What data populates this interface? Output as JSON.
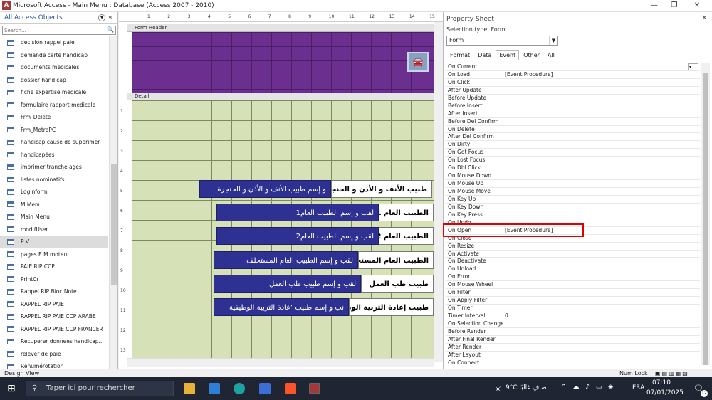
{
  "window": {
    "title": "Microsoft Access - Main Menu : Database (Access 2007 - 2010)",
    "icon": "A"
  },
  "nav": {
    "header": "All Access Objects",
    "search_placeholder": "Search...",
    "items": [
      {
        "label": "decision rappel paie"
      },
      {
        "label": "demande carte handicap"
      },
      {
        "label": "documents medicales"
      },
      {
        "label": "dossier handicap"
      },
      {
        "label": "fiche expertise medicale"
      },
      {
        "label": "formulaire rapport medicale"
      },
      {
        "label": "Frm_Delete"
      },
      {
        "label": "Frm_MetroPC"
      },
      {
        "label": "handicap cause de supprimer"
      },
      {
        "label": "handicapées"
      },
      {
        "label": "imprimer tranche ages"
      },
      {
        "label": "listes nominatifs"
      },
      {
        "label": "Loginform"
      },
      {
        "label": "M Menu"
      },
      {
        "label": "Main Menu"
      },
      {
        "label": "modifUser"
      },
      {
        "label": "P V",
        "selected": true
      },
      {
        "label": "pages E M moteur"
      },
      {
        "label": "PAIE RIP CCP"
      },
      {
        "label": "PrintCr"
      },
      {
        "label": "Rappel RIP Bloc Note"
      },
      {
        "label": "RAPPEL RIP PAIE"
      },
      {
        "label": "RAPPEL RIP PAIE CCP ARABE"
      },
      {
        "label": "RAPPEL RIP PAIE CCP FRANCER"
      },
      {
        "label": "Recuperer donnees handicap..."
      },
      {
        "label": "relever de paie"
      },
      {
        "label": "Renumérotation"
      }
    ]
  },
  "design": {
    "ruler_top": [
      "1",
      "2",
      "3",
      "4",
      "5",
      "6",
      "7",
      "8",
      "9",
      "10",
      "11",
      "12",
      "13",
      "14",
      "15"
    ],
    "ruler_left": [
      "1",
      "2",
      "3",
      "4",
      "5",
      "6",
      "7",
      "8",
      "9",
      "10",
      "11",
      "12",
      "13"
    ],
    "form_header_label": "Form Header",
    "detail_label": "Detail",
    "controls": [
      {
        "text": "و إسم طبيب الأنف و الأذن و الحنجرة",
        "style": "blue"
      },
      {
        "text": "طبيب الأنف و الأذن و الحنجرة",
        "style": "white"
      },
      {
        "text": "لقب و إسم الطبيب العام1",
        "style": "blue"
      },
      {
        "text": "الطبيب العام 1",
        "style": "white"
      },
      {
        "text": "لقب و إسم الطبيب العام2",
        "style": "blue"
      },
      {
        "text": "الطبيب العام 2",
        "style": "white"
      },
      {
        "text": "لقب و إسم الطبيب العام المستخلف",
        "style": "blue"
      },
      {
        "text": "الطبيب العام المستخلف",
        "style": "white"
      },
      {
        "text": "لقب و إسم طبيب طب العمل",
        "style": "blue"
      },
      {
        "text": "طبيب طب العمل",
        "style": "white"
      },
      {
        "text": "نب و إسم طبيب ’عادة التربية الوظيفية",
        "style": "blue"
      },
      {
        "text": "طبيب إعادة التربية الوظيفية",
        "style": "white"
      }
    ]
  },
  "property_sheet": {
    "title": "Property Sheet",
    "selection_type": "Selection type:  Form",
    "selected_object": "Form",
    "tabs": [
      "Format",
      "Data",
      "Event",
      "Other",
      "All"
    ],
    "active_tab": "Event",
    "highlighted_row": "On Open",
    "rows": [
      {
        "name": "On Current",
        "value": ""
      },
      {
        "name": "On Load",
        "value": "[Event Procedure]"
      },
      {
        "name": "On Click",
        "value": ""
      },
      {
        "name": "After Update",
        "value": ""
      },
      {
        "name": "Before Update",
        "value": ""
      },
      {
        "name": "Before Insert",
        "value": ""
      },
      {
        "name": "After Insert",
        "value": ""
      },
      {
        "name": "Before Del Confirm",
        "value": ""
      },
      {
        "name": "On Delete",
        "value": ""
      },
      {
        "name": "After Del Confirm",
        "value": ""
      },
      {
        "name": "On Dirty",
        "value": ""
      },
      {
        "name": "On Got Focus",
        "value": ""
      },
      {
        "name": "On Lost Focus",
        "value": ""
      },
      {
        "name": "On Dbl Click",
        "value": ""
      },
      {
        "name": "On Mouse Down",
        "value": ""
      },
      {
        "name": "On Mouse Up",
        "value": ""
      },
      {
        "name": "On Mouse Move",
        "value": ""
      },
      {
        "name": "On Key Up",
        "value": ""
      },
      {
        "name": "On Key Down",
        "value": ""
      },
      {
        "name": "On Key Press",
        "value": ""
      },
      {
        "name": "On Undo",
        "value": ""
      },
      {
        "name": "On Open",
        "value": "[Event Procedure]"
      },
      {
        "name": "On Close",
        "value": ""
      },
      {
        "name": "On Resize",
        "value": ""
      },
      {
        "name": "On Activate",
        "value": ""
      },
      {
        "name": "On Deactivate",
        "value": ""
      },
      {
        "name": "On Unload",
        "value": ""
      },
      {
        "name": "On Error",
        "value": ""
      },
      {
        "name": "On Mouse Wheel",
        "value": ""
      },
      {
        "name": "On Filter",
        "value": ""
      },
      {
        "name": "On Apply Filter",
        "value": ""
      },
      {
        "name": "On Timer",
        "value": ""
      },
      {
        "name": "Timer Interval",
        "value": "0"
      },
      {
        "name": "On Selection Change",
        "value": ""
      },
      {
        "name": "Before Render",
        "value": ""
      },
      {
        "name": "After Final Render",
        "value": ""
      },
      {
        "name": "After Render",
        "value": ""
      },
      {
        "name": "After Layout",
        "value": ""
      },
      {
        "name": "On Connect",
        "value": ""
      }
    ]
  },
  "status": {
    "left": "Design View",
    "right": "Num Lock"
  },
  "taskbar": {
    "search_placeholder": "Taper ici pour rechercher",
    "weather": "9°C  صافٍ غالبًا",
    "language": "FRA",
    "time": "07:10",
    "date": "07/01/2025",
    "notifications": "12"
  },
  "colors": {
    "header_purple": "#6b2f8f",
    "detail_green": "#d7e1b8",
    "control_blue": "#2e3192",
    "highlight_red": "#e00000",
    "accent_access": "#a4373a"
  }
}
